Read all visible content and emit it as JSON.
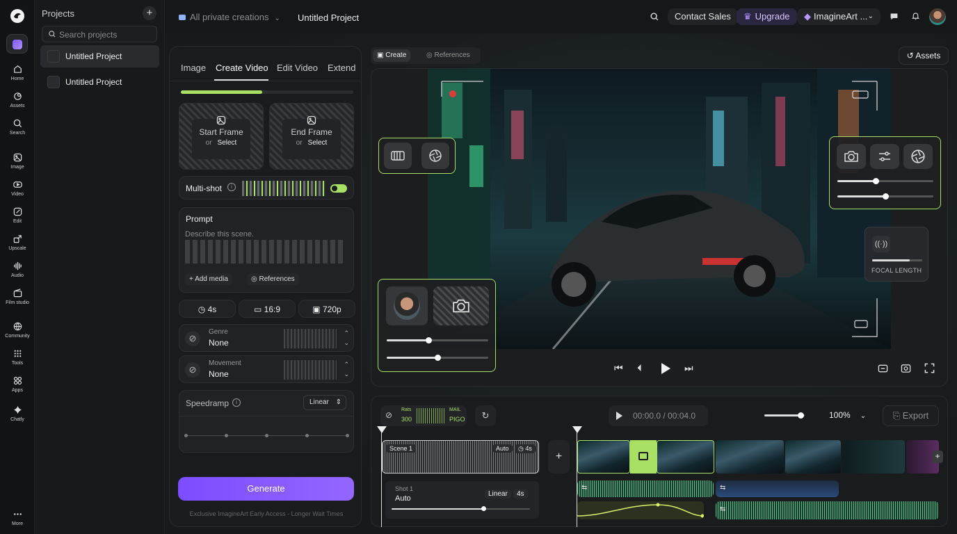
{
  "rail": {
    "items": [
      {
        "label": "Home",
        "icon": "home-icon"
      },
      {
        "label": "Assets",
        "icon": "assets-icon"
      },
      {
        "label": "Search",
        "icon": "search-icon"
      },
      {
        "label": "Image",
        "icon": "image-icon"
      },
      {
        "label": "Video",
        "icon": "video-icon"
      },
      {
        "label": "Edit",
        "icon": "edit-icon"
      },
      {
        "label": "Upscale",
        "icon": "upscale-icon"
      },
      {
        "label": "Audio",
        "icon": "audio-icon"
      },
      {
        "label": "Film studio",
        "icon": "film-icon"
      },
      {
        "label": "Community",
        "icon": "globe-icon"
      },
      {
        "label": "Tools",
        "icon": "grid-icon"
      },
      {
        "label": "Apps",
        "icon": "apps-icon"
      },
      {
        "label": "Chatly",
        "icon": "chatly-icon"
      }
    ],
    "more": "More"
  },
  "projects": {
    "title": "Projects",
    "search_placeholder": "Search projects",
    "items": [
      "Untitled Project",
      "Untitled Project"
    ]
  },
  "topbar": {
    "folder": "All private creations",
    "project": "Untitled Project",
    "contact": "Contact Sales",
    "upgrade": "Upgrade",
    "account": "ImagineArt ..."
  },
  "gen": {
    "tabs": [
      "Image",
      "Create Video",
      "Edit Video",
      "Extend"
    ],
    "progress": 0.47,
    "start": {
      "title": "Start Frame",
      "or": "or",
      "select": "Select"
    },
    "end": {
      "title": "End Frame",
      "or": "or",
      "select": "Select"
    },
    "multishot": "Multi-shot",
    "prompt_title": "Prompt",
    "prompt_placeholder": "Describe this scene.",
    "add_media": "Add media",
    "references": "References",
    "duration": "4s",
    "ratio": "16:9",
    "resolution": "720p",
    "genre_label": "Genre",
    "genre_value": "None",
    "movement_label": "Movement",
    "movement_value": "None",
    "speedramp": "Speedramp",
    "speedramp_value": "Linear",
    "generate": "Generate",
    "note": "Exclusive ImagineArt Early Access - Longer Wait Times"
  },
  "canvas": {
    "create": "Create",
    "references": "References",
    "assets": "Assets",
    "focal": "FOCAL LENGTH"
  },
  "timeline": {
    "time": "00:00.0 / 00:04.0",
    "zoom": "100%",
    "export": "Export",
    "scene": "Scene 1",
    "scene_mode": "Auto",
    "scene_dur": "4s",
    "shot": "Shot 1",
    "shot_mode": "Auto",
    "shot_ramp": "Linear",
    "shot_dur": "4s",
    "meter_a": "300",
    "meter_b": "PIGO",
    "meter_c": "Rats",
    "meter_d": "MAIL"
  }
}
